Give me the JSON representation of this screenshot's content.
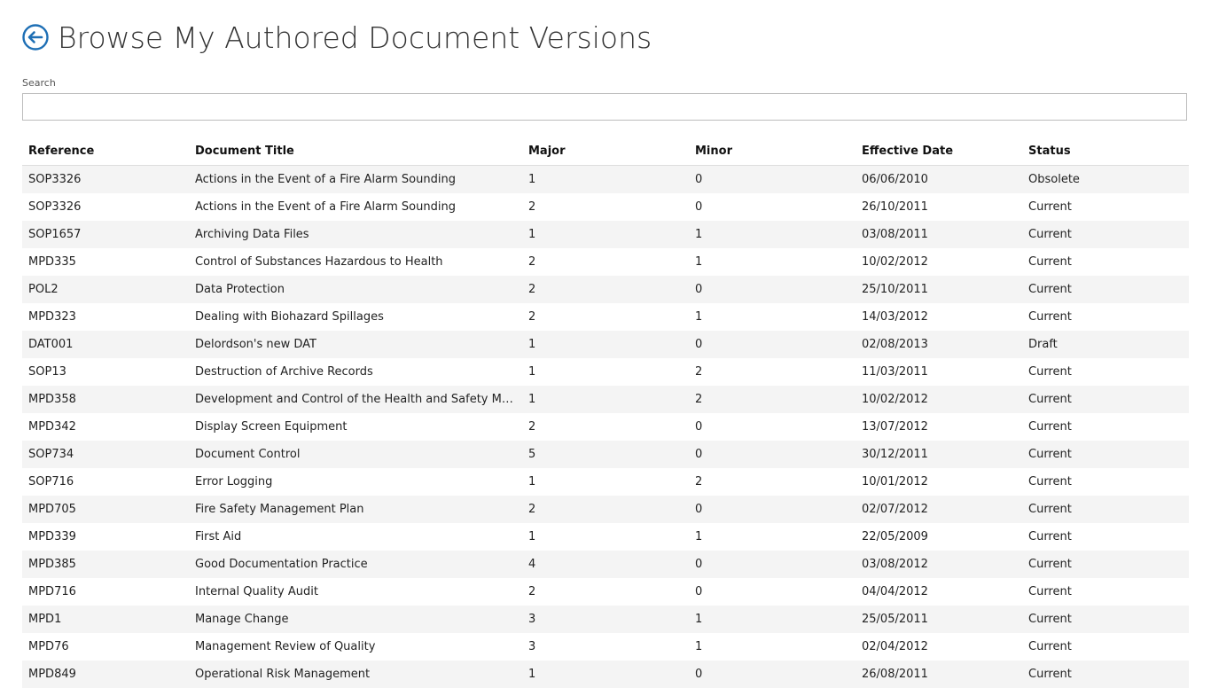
{
  "page": {
    "title": "Browse My Authored Document Versions",
    "back_icon": "back-arrow-circle-icon"
  },
  "search": {
    "label": "Search",
    "value": "",
    "placeholder": ""
  },
  "table": {
    "columns": [
      "Reference",
      "Document Title",
      "Major",
      "Minor",
      "Effective Date",
      "Status"
    ],
    "rows": [
      [
        "SOP3326",
        "Actions in the Event of a Fire Alarm Sounding",
        "1",
        "0",
        "06/06/2010",
        "Obsolete"
      ],
      [
        "SOP3326",
        "Actions in the Event of a Fire Alarm Sounding",
        "2",
        "0",
        "26/10/2011",
        "Current"
      ],
      [
        "SOP1657",
        "Archiving Data Files",
        "1",
        "1",
        "03/08/2011",
        "Current"
      ],
      [
        "MPD335",
        "Control of Substances Hazardous to Health",
        "2",
        "1",
        "10/02/2012",
        "Current"
      ],
      [
        "POL2",
        "Data Protection",
        "2",
        "0",
        "25/10/2011",
        "Current"
      ],
      [
        "MPD323",
        "Dealing with Biohazard Spillages",
        "2",
        "1",
        "14/03/2012",
        "Current"
      ],
      [
        "DAT001",
        "Delordson's new DAT",
        "1",
        "0",
        "02/08/2013",
        "Draft"
      ],
      [
        "SOP13",
        "Destruction of Archive Records",
        "1",
        "2",
        "11/03/2011",
        "Current"
      ],
      [
        "MPD358",
        "Development and Control of the Health and Safety Mana...",
        "1",
        "2",
        "10/02/2012",
        "Current"
      ],
      [
        "MPD342",
        "Display Screen Equipment",
        "2",
        "0",
        "13/07/2012",
        "Current"
      ],
      [
        "SOP734",
        "Document Control",
        "5",
        "0",
        "30/12/2011",
        "Current"
      ],
      [
        "SOP716",
        "Error Logging",
        "1",
        "2",
        "10/01/2012",
        "Current"
      ],
      [
        "MPD705",
        "Fire Safety Management Plan",
        "2",
        "0",
        "02/07/2012",
        "Current"
      ],
      [
        "MPD339",
        "First Aid",
        "1",
        "1",
        "22/05/2009",
        "Current"
      ],
      [
        "MPD385",
        "Good Documentation Practice",
        "4",
        "0",
        "03/08/2012",
        "Current"
      ],
      [
        "MPD716",
        "Internal Quality Audit",
        "2",
        "0",
        "04/04/2012",
        "Current"
      ],
      [
        "MPD1",
        "Manage Change",
        "3",
        "1",
        "25/05/2011",
        "Current"
      ],
      [
        "MPD76",
        "Management Review of Quality",
        "3",
        "1",
        "02/04/2012",
        "Current"
      ],
      [
        "MPD849",
        "Operational Risk Management",
        "1",
        "0",
        "26/08/2011",
        "Current"
      ]
    ]
  },
  "colors": {
    "accent": "#1e6fb5",
    "row_alt": "#f4f4f4",
    "text": "#222222"
  }
}
